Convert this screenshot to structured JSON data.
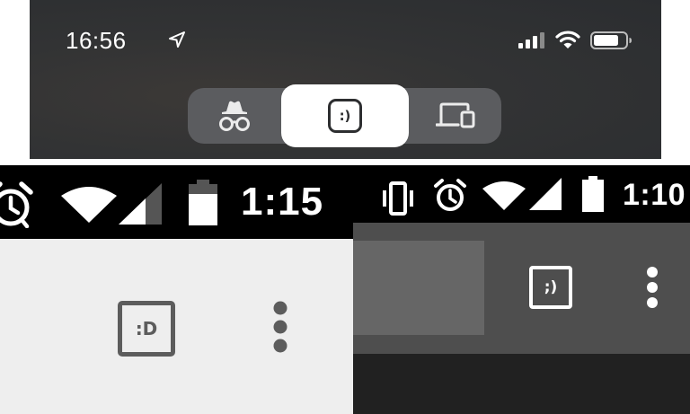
{
  "ios": {
    "status_time": "16:56",
    "icons": [
      "location-arrow-icon",
      "cellular-signal-icon",
      "wifi-icon",
      "battery-icon"
    ],
    "tab_switcher": {
      "tabs": [
        {
          "name": "incognito",
          "icon": "incognito-icon",
          "selected": false
        },
        {
          "name": "normal",
          "icon": "tab-counter-icon",
          "label": ":)",
          "selected": true
        },
        {
          "name": "devices",
          "icon": "devices-icon",
          "selected": false
        }
      ]
    }
  },
  "android_left": {
    "status_time": "1:15",
    "icons": [
      "alarm-icon",
      "wifi-icon",
      "cellular-signal-icon",
      "battery-icon"
    ],
    "toolbar": {
      "tab_counter_label": ":D",
      "menu_icon": "more-vert-icon"
    }
  },
  "android_right": {
    "status_time": "1:10",
    "icons": [
      "vibrate-icon",
      "alarm-icon",
      "wifi-icon",
      "cellular-signal-icon",
      "battery-icon"
    ],
    "toolbar": {
      "tab_counter_label": ";)",
      "menu_icon": "more-vert-icon"
    }
  }
}
